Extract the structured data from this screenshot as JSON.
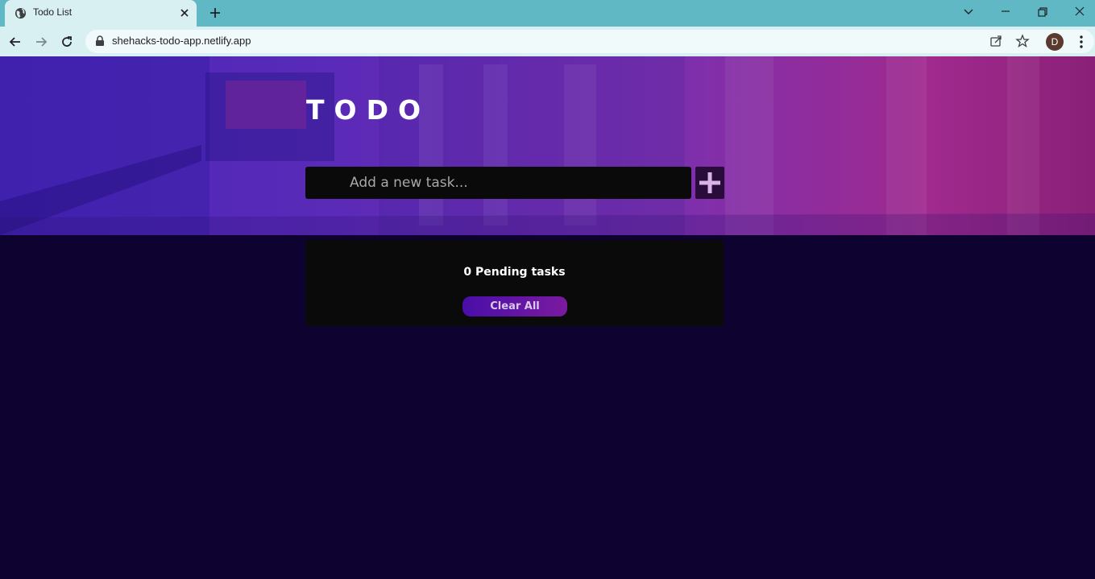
{
  "browser": {
    "tab_title": "Todo List",
    "url": "shehacks-todo-app.netlify.app",
    "profile_initial": "D",
    "icons": [
      "globe-icon",
      "close-icon",
      "plus-icon",
      "chevron-down-icon",
      "minimize-icon",
      "restore-icon",
      "window-close-icon",
      "back-icon",
      "forward-icon",
      "reload-icon",
      "lock-icon",
      "share-icon",
      "star-icon",
      "more-icon"
    ]
  },
  "app": {
    "title": "TODO",
    "input_placeholder": "Add a new task...",
    "add_button_icon": "plus-icon",
    "pending_text": "0 Pending tasks",
    "clear_label": "Clear All"
  },
  "colors": {
    "page_bg": "#0d0230",
    "hero_start": "#4a26b8",
    "hero_end": "#a02a8e",
    "panel_bg": "#0a0a0a",
    "tabbar": "#5fb8c3",
    "toolbar": "#d9f0f2"
  }
}
